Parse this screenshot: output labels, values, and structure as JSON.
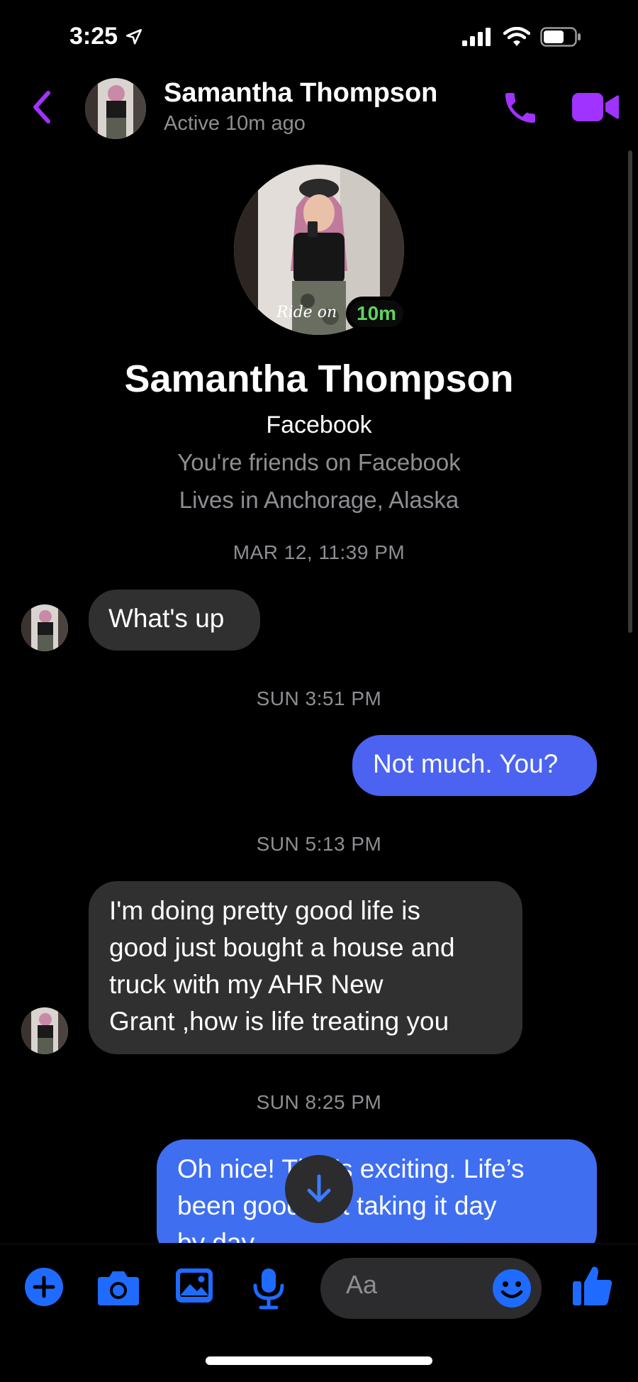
{
  "status_bar": {
    "time": "3:25"
  },
  "header": {
    "name": "Samantha Thompson",
    "status": "Active 10m ago"
  },
  "profile": {
    "name": "Samantha Thompson",
    "platform": "Facebook",
    "friends_line": "You're friends on Facebook",
    "location_line": "Lives in Anchorage, Alaska",
    "active_badge": "10m",
    "photo_caption": "Ride on"
  },
  "messages": [
    {
      "type": "timestamp",
      "text": "MAR 12, 11:39 PM"
    },
    {
      "type": "incoming",
      "lines": [
        "What's up"
      ]
    },
    {
      "type": "timestamp",
      "text": "SUN 3:51 PM"
    },
    {
      "type": "outgoing",
      "lines": [
        "Not much. You?"
      ]
    },
    {
      "type": "timestamp",
      "text": "SUN 5:13 PM"
    },
    {
      "type": "incoming",
      "lines": [
        "I'm doing pretty good life is",
        "good just bought a house and",
        "truck with my AHR New",
        "Grant ,how is life treating you"
      ]
    },
    {
      "type": "timestamp",
      "text": "SUN 8:25 PM"
    },
    {
      "type": "outgoing",
      "lines": [
        "Oh nice! That’s exciting.  Life’s",
        "been good just taking it day",
        "by day"
      ]
    }
  ],
  "composer": {
    "placeholder": "Aa"
  },
  "colors": {
    "accent": "#a033ff",
    "composer_icons": "#1f6bff",
    "outgoing_bubble": "#4b63f0",
    "incoming_bubble": "#303030"
  }
}
